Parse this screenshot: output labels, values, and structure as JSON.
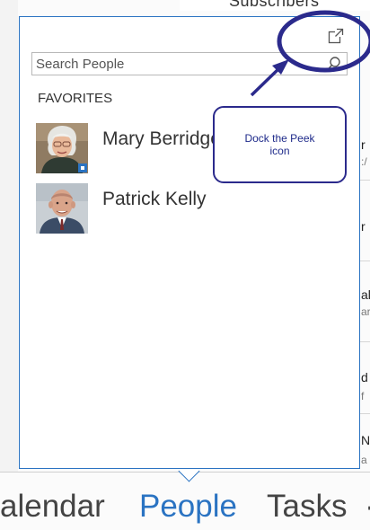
{
  "background": {
    "top_text": "Subscribers",
    "right_fragments": [
      "r",
      ":/",
      "r",
      "al",
      "ar",
      "d",
      "f",
      "N",
      "a"
    ]
  },
  "peek": {
    "search_placeholder": "Search People",
    "section_label": "FAVORITES",
    "contacts": [
      {
        "name": "Mary Berridge",
        "presence": "online"
      },
      {
        "name": "Patrick Kelly"
      }
    ]
  },
  "annotation": {
    "text": "Dock the Peek icon",
    "color": "#1f1f8a"
  },
  "nav": {
    "items": [
      "alendar",
      "People",
      "Tasks",
      "·"
    ],
    "active": "People"
  },
  "colors": {
    "accent": "#2a73c2",
    "annotation": "#1f1f8a"
  }
}
